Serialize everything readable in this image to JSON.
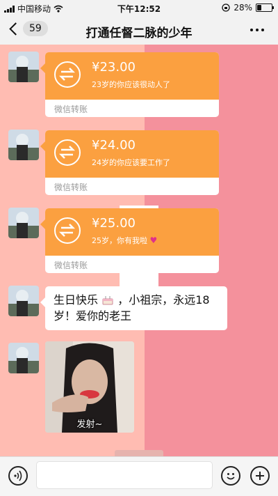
{
  "status_bar": {
    "carrier": "中国移动",
    "time": "下午12:52",
    "battery": "28%",
    "battery_level": 0.28,
    "icons": [
      "signal-icon",
      "wifi-icon",
      "lock-rotation-icon",
      "battery-icon"
    ]
  },
  "nav": {
    "back_badge": "59",
    "title": "打通任督二脉的少年",
    "icons": [
      "back-chevron-icon",
      "more-icon"
    ]
  },
  "messages": {
    "transfers": [
      {
        "amount": "¥23.00",
        "note": "23岁的你应该很动人了",
        "label": "微信转账"
      },
      {
        "amount": "¥24.00",
        "note": "24岁的你应该要工作了",
        "label": "微信转账"
      },
      {
        "amount": "¥25.00",
        "note": "25岁，你有我啦",
        "label": "微信转账"
      }
    ],
    "text_line1": "生日快乐",
    "text_line1b": "，小祖宗，永远18",
    "text_line2": "岁！爱你的老王",
    "sticker_caption": "发射~"
  },
  "input_bar": {
    "placeholder": "",
    "icons": [
      "voice-icon",
      "emoji-icon",
      "plus-icon"
    ]
  },
  "colors": {
    "transfer_orange": "#fba040",
    "bg_left": "#ffbcb2",
    "bg_right": "#f4919c"
  }
}
